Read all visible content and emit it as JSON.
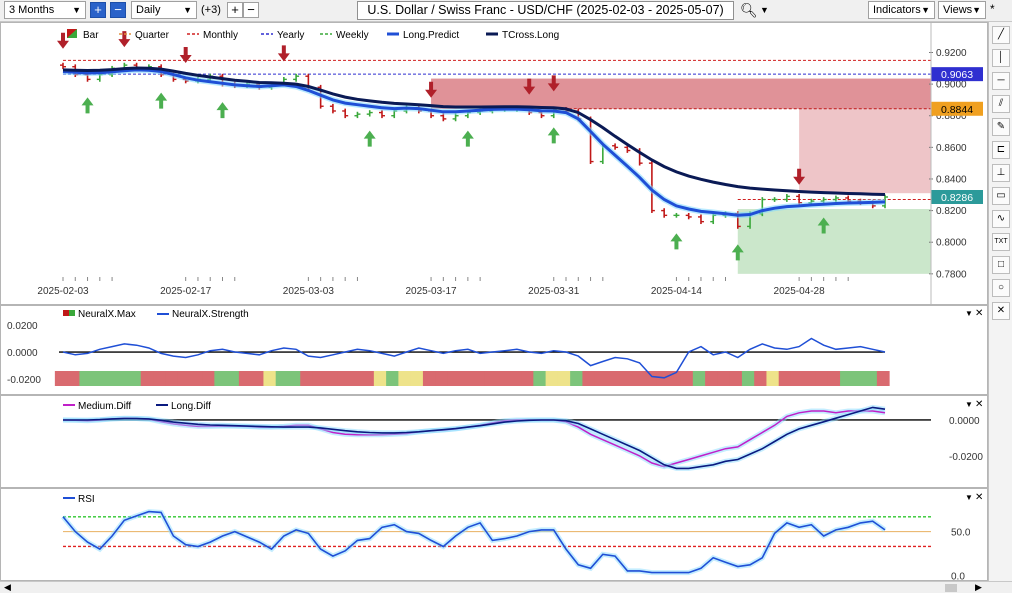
{
  "toolbar": {
    "period": "3 Months",
    "interval": "Daily",
    "plus_count": "(+3)",
    "title": "U.S. Dollar / Swiss Franc - USD/CHF (2025-02-03 - 2025-05-07)",
    "indicators_label": "Indicators",
    "views_label": "Views"
  },
  "colors": {
    "up_arrow": "#4caf50",
    "down_arrow": "#b0202a",
    "long_predict": "#1f4fd6",
    "tcross_long": "#0a1a55",
    "resistance_zone": "#d56d75",
    "support_zone": "#8cc98c",
    "yearly_label": "#2f2fd0",
    "monthly_label": "#f0a020",
    "price_label": "#2c9a9a"
  },
  "chart_data": [
    {
      "type": "line",
      "panel": "price",
      "dates": [
        "2025-02-03",
        "2025-02-04",
        "2025-02-05",
        "2025-02-06",
        "2025-02-07",
        "2025-02-10",
        "2025-02-11",
        "2025-02-12",
        "2025-02-13",
        "2025-02-14",
        "2025-02-17",
        "2025-02-18",
        "2025-02-19",
        "2025-02-20",
        "2025-02-21",
        "2025-02-24",
        "2025-02-25",
        "2025-02-26",
        "2025-02-27",
        "2025-02-28",
        "2025-03-03",
        "2025-03-04",
        "2025-03-05",
        "2025-03-06",
        "2025-03-07",
        "2025-03-10",
        "2025-03-11",
        "2025-03-12",
        "2025-03-13",
        "2025-03-14",
        "2025-03-17",
        "2025-03-18",
        "2025-03-19",
        "2025-03-20",
        "2025-03-21",
        "2025-03-24",
        "2025-03-25",
        "2025-03-26",
        "2025-03-27",
        "2025-03-28",
        "2025-03-31",
        "2025-04-01",
        "2025-04-02",
        "2025-04-03",
        "2025-04-04",
        "2025-04-07",
        "2025-04-08",
        "2025-04-09",
        "2025-04-10",
        "2025-04-11",
        "2025-04-14",
        "2025-04-15",
        "2025-04-16",
        "2025-04-17",
        "2025-04-18",
        "2025-04-21",
        "2025-04-22",
        "2025-04-23",
        "2025-04-24",
        "2025-04-25",
        "2025-04-28",
        "2025-04-29",
        "2025-04-30",
        "2025-05-01",
        "2025-05-02",
        "2025-05-05",
        "2025-05-06",
        "2025-05-07"
      ],
      "x_tick_labels": [
        "2025-02-03",
        "2025-02-17",
        "2025-03-03",
        "2025-03-17",
        "2025-03-31",
        "2025-04-14",
        "2025-04-28"
      ],
      "y_tick_labels": [
        "0.9200",
        "0.9000",
        "0.8800",
        "0.8600",
        "0.8400",
        "0.8200",
        "0.8000",
        "0.7800"
      ],
      "ylim": [
        0.778,
        0.926
      ],
      "legend": [
        "Bar",
        "Quarter",
        "Monthly",
        "Yearly",
        "Weekly",
        "Long.Predict",
        "TCross.Long"
      ],
      "close": [
        0.911,
        0.906,
        0.903,
        0.906,
        0.91,
        0.912,
        0.91,
        0.911,
        0.906,
        0.903,
        0.902,
        0.903,
        0.905,
        0.9,
        0.899,
        0.9,
        0.898,
        0.9,
        0.903,
        0.905,
        0.898,
        0.886,
        0.883,
        0.88,
        0.881,
        0.882,
        0.88,
        0.883,
        0.885,
        0.883,
        0.88,
        0.878,
        0.88,
        0.882,
        0.883,
        0.884,
        0.884,
        0.884,
        0.882,
        0.88,
        0.884,
        0.883,
        0.878,
        0.851,
        0.861,
        0.86,
        0.858,
        0.85,
        0.82,
        0.817,
        0.817,
        0.816,
        0.813,
        0.817,
        0.818,
        0.81,
        0.818,
        0.827,
        0.827,
        0.829,
        0.825,
        0.826,
        0.827,
        0.828,
        0.826,
        0.825,
        0.823,
        0.8286
      ],
      "long_predict": [
        0.908,
        0.9075,
        0.907,
        0.9072,
        0.9078,
        0.9085,
        0.909,
        0.9088,
        0.908,
        0.906,
        0.904,
        0.9025,
        0.9015,
        0.9005,
        0.8995,
        0.899,
        0.8985,
        0.899,
        0.8995,
        0.8985,
        0.896,
        0.893,
        0.89,
        0.888,
        0.887,
        0.886,
        0.885,
        0.8845,
        0.8848,
        0.8845,
        0.8835,
        0.8825,
        0.8825,
        0.883,
        0.8835,
        0.884,
        0.8842,
        0.8842,
        0.8838,
        0.8832,
        0.883,
        0.882,
        0.878,
        0.87,
        0.862,
        0.855,
        0.848,
        0.841,
        0.833,
        0.827,
        0.823,
        0.821,
        0.8195,
        0.8188,
        0.818,
        0.817,
        0.8175,
        0.82,
        0.8215,
        0.8225,
        0.823,
        0.8236,
        0.824,
        0.8245,
        0.8248,
        0.825,
        0.8252,
        0.8255
      ],
      "tcross_long": [
        0.909,
        0.9088,
        0.9086,
        0.9088,
        0.9092,
        0.9098,
        0.9102,
        0.91,
        0.9095,
        0.9082,
        0.9068,
        0.9055,
        0.9045,
        0.9035,
        0.9025,
        0.9018,
        0.901,
        0.9008,
        0.9006,
        0.9,
        0.8985,
        0.8962,
        0.8938,
        0.8918,
        0.8904,
        0.8894,
        0.8885,
        0.8878,
        0.8874,
        0.887,
        0.8864,
        0.8858,
        0.8855,
        0.8855,
        0.8855,
        0.8856,
        0.8857,
        0.8857,
        0.8855,
        0.8852,
        0.885,
        0.8843,
        0.882,
        0.8775,
        0.8725,
        0.867,
        0.8618,
        0.8568,
        0.852,
        0.8478,
        0.8445,
        0.8418,
        0.8398,
        0.838,
        0.8365,
        0.8352,
        0.8342,
        0.8336,
        0.833,
        0.8325,
        0.8321,
        0.8317,
        0.8314,
        0.8311,
        0.8308,
        0.8306,
        0.8304,
        0.8302
      ],
      "buy_signal_dates": [
        "2025-02-05",
        "2025-02-13",
        "2025-02-20",
        "2025-03-10",
        "2025-03-20",
        "2025-03-31",
        "2025-04-14",
        "2025-04-21",
        "2025-04-30"
      ],
      "sell_signal_dates": [
        "2025-02-03",
        "2025-02-10",
        "2025-02-17",
        "2025-02-27",
        "2025-03-17",
        "2025-03-27",
        "2025-03-31",
        "2025-04-28"
      ],
      "price_labels": [
        "0.9063",
        "0.8844",
        "0.8286"
      ],
      "price_label_values": [
        0.9063,
        0.8844,
        0.8286
      ],
      "resistance_zone": {
        "start": "2025-03-17",
        "end": "2025-05-07",
        "low": 0.8844,
        "high": 0.9035
      },
      "resistance_zone_lower": {
        "start": "2025-04-28",
        "end": "2025-05-07",
        "low": 0.831,
        "high": 0.8844
      },
      "support_zone": {
        "start": "2025-04-21",
        "end": "2025-05-07",
        "low": 0.78,
        "high": 0.821
      },
      "yearly_level": 0.9063,
      "monthly_level": 0.915,
      "weekly_level": 0.8844,
      "quarter_level": 0.827,
      "grid": false
    },
    {
      "type": "line",
      "panel": "neuralx",
      "legend": [
        "NeuralX.Max",
        "NeuralX.Strength"
      ],
      "y_tick_labels": [
        "0.0200",
        "0.0000",
        "-0.0200"
      ],
      "ylim": [
        -0.025,
        0.028
      ],
      "strength": [
        0.0,
        -0.002,
        -0.001,
        0.002,
        0.004,
        0.006,
        0.005,
        0.003,
        -0.001,
        -0.003,
        -0.004,
        -0.002,
        0.001,
        0.002,
        0.0,
        -0.001,
        -0.002,
        0.001,
        0.003,
        0.002,
        -0.003,
        -0.004,
        -0.002,
        0.0,
        0.002,
        0.001,
        -0.001,
        -0.003,
        0.0,
        0.003,
        0.001,
        -0.001,
        0.001,
        0.002,
        -0.001,
        0.0,
        0.001,
        0.002,
        0.0,
        -0.001,
        0.001,
        0.0,
        -0.003,
        -0.01,
        -0.007,
        -0.004,
        -0.005,
        -0.008,
        -0.018,
        -0.019,
        -0.015,
        0.0,
        0.004,
        -0.002,
        0.0,
        -0.004,
        0.002,
        0.006,
        0.003,
        0.002,
        0.004,
        0.01,
        0.005,
        0.002,
        0.003,
        0.004,
        0.002,
        0.0
      ],
      "max_line": 0.0,
      "heat_colors": [
        "red",
        "red",
        "green",
        "green",
        "green",
        "green",
        "green",
        "red",
        "red",
        "red",
        "red",
        "red",
        "red",
        "green",
        "green",
        "red",
        "red",
        "yellow",
        "green",
        "green",
        "red",
        "red",
        "red",
        "red",
        "red",
        "red",
        "yellow",
        "green",
        "yellow",
        "yellow",
        "red",
        "red",
        "red",
        "red",
        "red",
        "red",
        "red",
        "red",
        "red",
        "green",
        "yellow",
        "yellow",
        "green",
        "red",
        "red",
        "red",
        "red",
        "red",
        "red",
        "red",
        "red",
        "red",
        "green",
        "red",
        "red",
        "red",
        "green",
        "red",
        "yellow",
        "red",
        "red",
        "red",
        "red",
        "red",
        "green",
        "green",
        "green",
        "red"
      ]
    },
    {
      "type": "line",
      "panel": "diff",
      "legend": [
        "Medium.Diff",
        "Long.Diff"
      ],
      "y_tick_labels": [
        "0.0000",
        "-0.0200"
      ],
      "ylim": [
        -0.034,
        0.01
      ],
      "medium_diff": [
        0.0,
        -0.0002,
        -0.0004,
        0.0,
        0.0006,
        0.001,
        0.0008,
        0.0004,
        -0.001,
        -0.0022,
        -0.003,
        -0.0036,
        -0.0036,
        -0.0034,
        -0.0034,
        -0.0036,
        -0.004,
        -0.004,
        -0.0036,
        -0.003,
        -0.003,
        -0.005,
        -0.007,
        -0.008,
        -0.0082,
        -0.0082,
        -0.0082,
        -0.008,
        -0.0076,
        -0.0066,
        -0.006,
        -0.0056,
        -0.005,
        -0.004,
        -0.003,
        -0.0016,
        -0.0004,
        0.0,
        0.0,
        0.0,
        0.0,
        -0.001,
        -0.004,
        -0.008,
        -0.011,
        -0.014,
        -0.017,
        -0.02,
        -0.024,
        -0.026,
        -0.024,
        -0.022,
        -0.02,
        -0.018,
        -0.016,
        -0.015,
        -0.011,
        -0.007,
        -0.003,
        0.002,
        0.004,
        0.005,
        0.005,
        0.004,
        0.005,
        0.005,
        0.005,
        0.004
      ],
      "long_diff": [
        0.0,
        0.0,
        0.0,
        0.0002,
        0.0006,
        0.0008,
        0.0008,
        0.0006,
        -0.0002,
        -0.0012,
        -0.0018,
        -0.0024,
        -0.0028,
        -0.003,
        -0.0032,
        -0.0034,
        -0.0036,
        -0.0038,
        -0.004,
        -0.004,
        -0.004,
        -0.0044,
        -0.0052,
        -0.006,
        -0.0066,
        -0.007,
        -0.0072,
        -0.0072,
        -0.007,
        -0.0066,
        -0.006,
        -0.0054,
        -0.0048,
        -0.004,
        -0.0032,
        -0.0022,
        -0.0012,
        -0.0006,
        -0.0002,
        0.0,
        0.0,
        -0.0004,
        -0.002,
        -0.005,
        -0.008,
        -0.011,
        -0.014,
        -0.017,
        -0.021,
        -0.025,
        -0.027,
        -0.027,
        -0.026,
        -0.025,
        -0.023,
        -0.022,
        -0.019,
        -0.016,
        -0.012,
        -0.008,
        -0.005,
        -0.003,
        -0.001,
        0.001,
        0.003,
        0.005,
        0.007,
        0.006
      ],
      "zero_line": 0.0
    },
    {
      "type": "line",
      "panel": "rsi",
      "legend": [
        "RSI"
      ],
      "y_tick_labels": [
        "50.0",
        "0.0"
      ],
      "ylim": [
        -2,
        92
      ],
      "rsi": [
        67,
        50,
        38,
        30,
        45,
        63,
        68,
        73,
        72,
        45,
        35,
        33,
        38,
        45,
        50,
        44,
        38,
        30,
        45,
        52,
        48,
        30,
        22,
        28,
        40,
        42,
        55,
        58,
        50,
        48,
        40,
        33,
        45,
        55,
        60,
        40,
        42,
        45,
        50,
        52,
        52,
        30,
        12,
        8,
        24,
        22,
        5,
        5,
        3,
        3,
        3,
        3,
        8,
        20,
        15,
        10,
        12,
        20,
        48,
        60,
        55,
        58,
        45,
        52,
        55,
        60,
        62,
        52
      ],
      "overbought": 67,
      "mid": 50,
      "oversold": 33
    }
  ]
}
